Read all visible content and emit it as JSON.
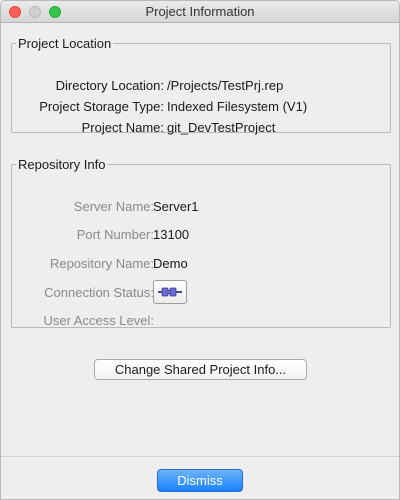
{
  "window": {
    "title": "Project Information"
  },
  "project_location": {
    "legend": "Project Location",
    "rows": [
      {
        "label": "Directory Location:",
        "value": "/Projects/TestPrj.rep"
      },
      {
        "label": "Project Storage Type:",
        "value": "Indexed Filesystem (V1)"
      },
      {
        "label": "Project Name:",
        "value": "git_DevTestProject"
      }
    ]
  },
  "repository_info": {
    "legend": "Repository Info",
    "server_name_label": "Server Name:",
    "server_name_value": "Server1",
    "port_number_label": "Port Number:",
    "port_number_value": "13100",
    "repository_name_label": "Repository Name:",
    "repository_name_value": "Demo",
    "connection_status_label": "Connection Status:",
    "connection_status_icon": "connected-plug-icon",
    "user_access_level_label": "User Access Level:"
  },
  "actions": {
    "change_shared_label": "Change Shared Project Info...",
    "dismiss_label": "Dismiss"
  },
  "colors": {
    "dismiss_accent": "#1a82fb",
    "close_button": "#fc5f57",
    "maximize_button": "#34c84a"
  }
}
